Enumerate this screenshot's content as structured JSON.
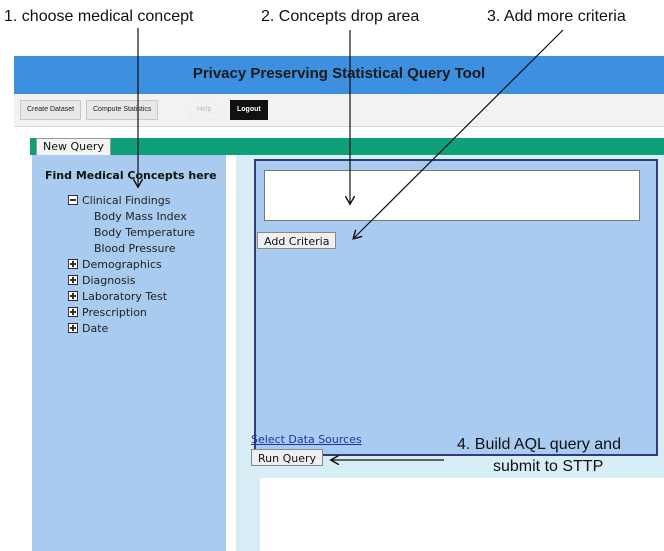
{
  "annotations": {
    "a1": "1. choose medical concept",
    "a2": "2. Concepts drop area",
    "a3": "3. Add more criteria",
    "a4_line1": "4. Build AQL query and",
    "a4_line2": "submit to STTP"
  },
  "app": {
    "title": "Privacy Preserving Statistical Query Tool"
  },
  "tabs": [
    {
      "label": "Create Dataset"
    },
    {
      "label": "Compute Statistics"
    },
    {
      "label": "Help"
    },
    {
      "label": "Logout"
    }
  ],
  "new_query_label": "New Query",
  "concepts": {
    "heading": "Find Medical Concepts here",
    "expanded": {
      "label": "Clinical Findings",
      "children": [
        "Body Mass Index",
        "Body Temperature",
        "Blood Pressure"
      ]
    },
    "collapsed": [
      "Demographics",
      "Diagnosis",
      "Laboratory Test",
      "Prescription",
      "Date"
    ]
  },
  "add_criteria_label": "Add Criteria",
  "select_sources_label": "Select Data Sources",
  "run_query_label": "Run Query",
  "colors": {
    "title_bar": "#3d8fe0",
    "green_bar": "#0fa07a",
    "panel_blue": "#a8cbef",
    "panel_border": "#333a7a",
    "right_bg": "#d8eef6"
  },
  "icons": {
    "expanded": "minus-box-icon",
    "collapsed": "plus-box-icon"
  }
}
